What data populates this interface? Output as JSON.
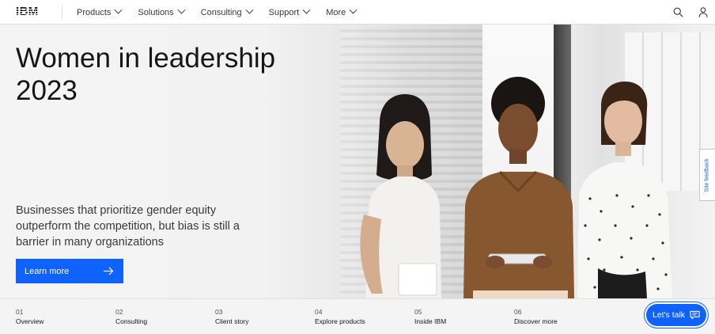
{
  "header": {
    "logo_text": "IBM",
    "nav": [
      {
        "label": "Products"
      },
      {
        "label": "Solutions"
      },
      {
        "label": "Consulting"
      },
      {
        "label": "Support"
      },
      {
        "label": "More"
      }
    ],
    "icons": [
      "search-icon",
      "user-icon"
    ]
  },
  "hero": {
    "title_line1": "Women in leadership",
    "title_line2": "2023",
    "subtitle": "Businesses that prioritize gender equity outperform the competition, but bias is still a barrier in many organizations",
    "cta_label": "Learn more",
    "cta_icon": "arrow-right-icon"
  },
  "feedback": {
    "label": "Site feedback"
  },
  "tabs": [
    {
      "num": "01",
      "label": "Overview"
    },
    {
      "num": "02",
      "label": "Consulting"
    },
    {
      "num": "03",
      "label": "Client story"
    },
    {
      "num": "04",
      "label": "Explore products"
    },
    {
      "num": "05",
      "label": "Inside IBM"
    },
    {
      "num": "06",
      "label": "Discover more"
    }
  ],
  "chat": {
    "label": "Let's talk",
    "icon": "chat-icon"
  },
  "colors": {
    "accent": "#0f62fe",
    "text": "#161616",
    "nav_text": "#393939"
  }
}
